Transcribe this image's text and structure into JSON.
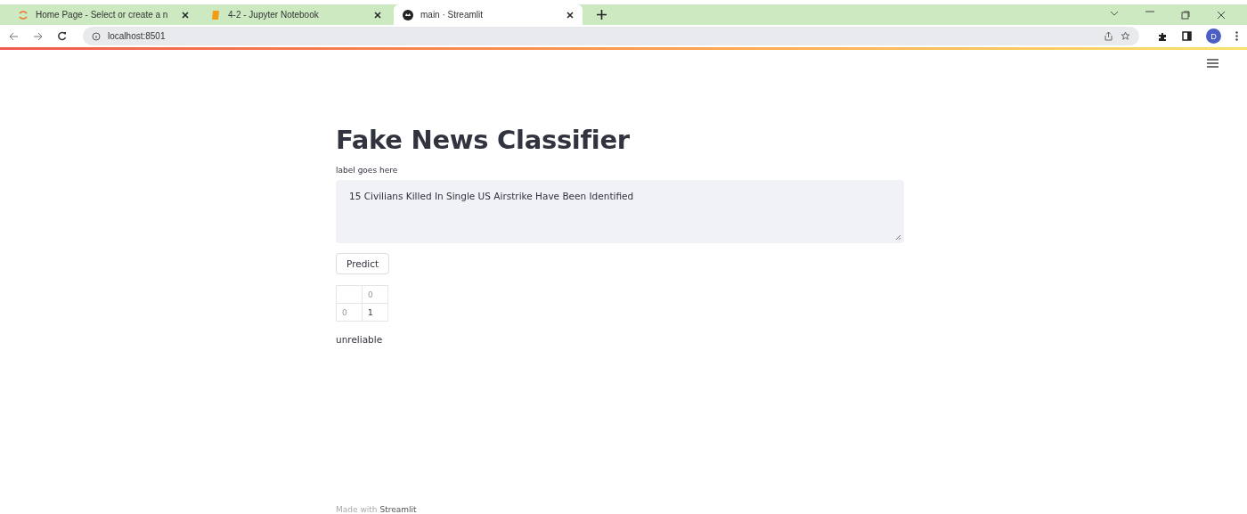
{
  "browser": {
    "tabs": [
      {
        "title": "Home Page - Select or create a n",
        "selected": false
      },
      {
        "title": "4-2 - Jupyter Notebook",
        "selected": false
      },
      {
        "title": "main · Streamlit",
        "selected": true
      }
    ],
    "url": "localhost:8501",
    "profile_initial": "D"
  },
  "app": {
    "title": "Fake News Classifier",
    "input_label": "label goes here",
    "input_value": "15 Civilians Killed In Single US Airstrike Have Been Identified",
    "button": "Predict",
    "table": {
      "columns": [
        "0"
      ],
      "rows": [
        {
          "index": "0",
          "cells": [
            "1"
          ]
        }
      ]
    },
    "result": "unreliable",
    "footer": {
      "prefix": "Made with",
      "brand": "Streamlit"
    }
  }
}
